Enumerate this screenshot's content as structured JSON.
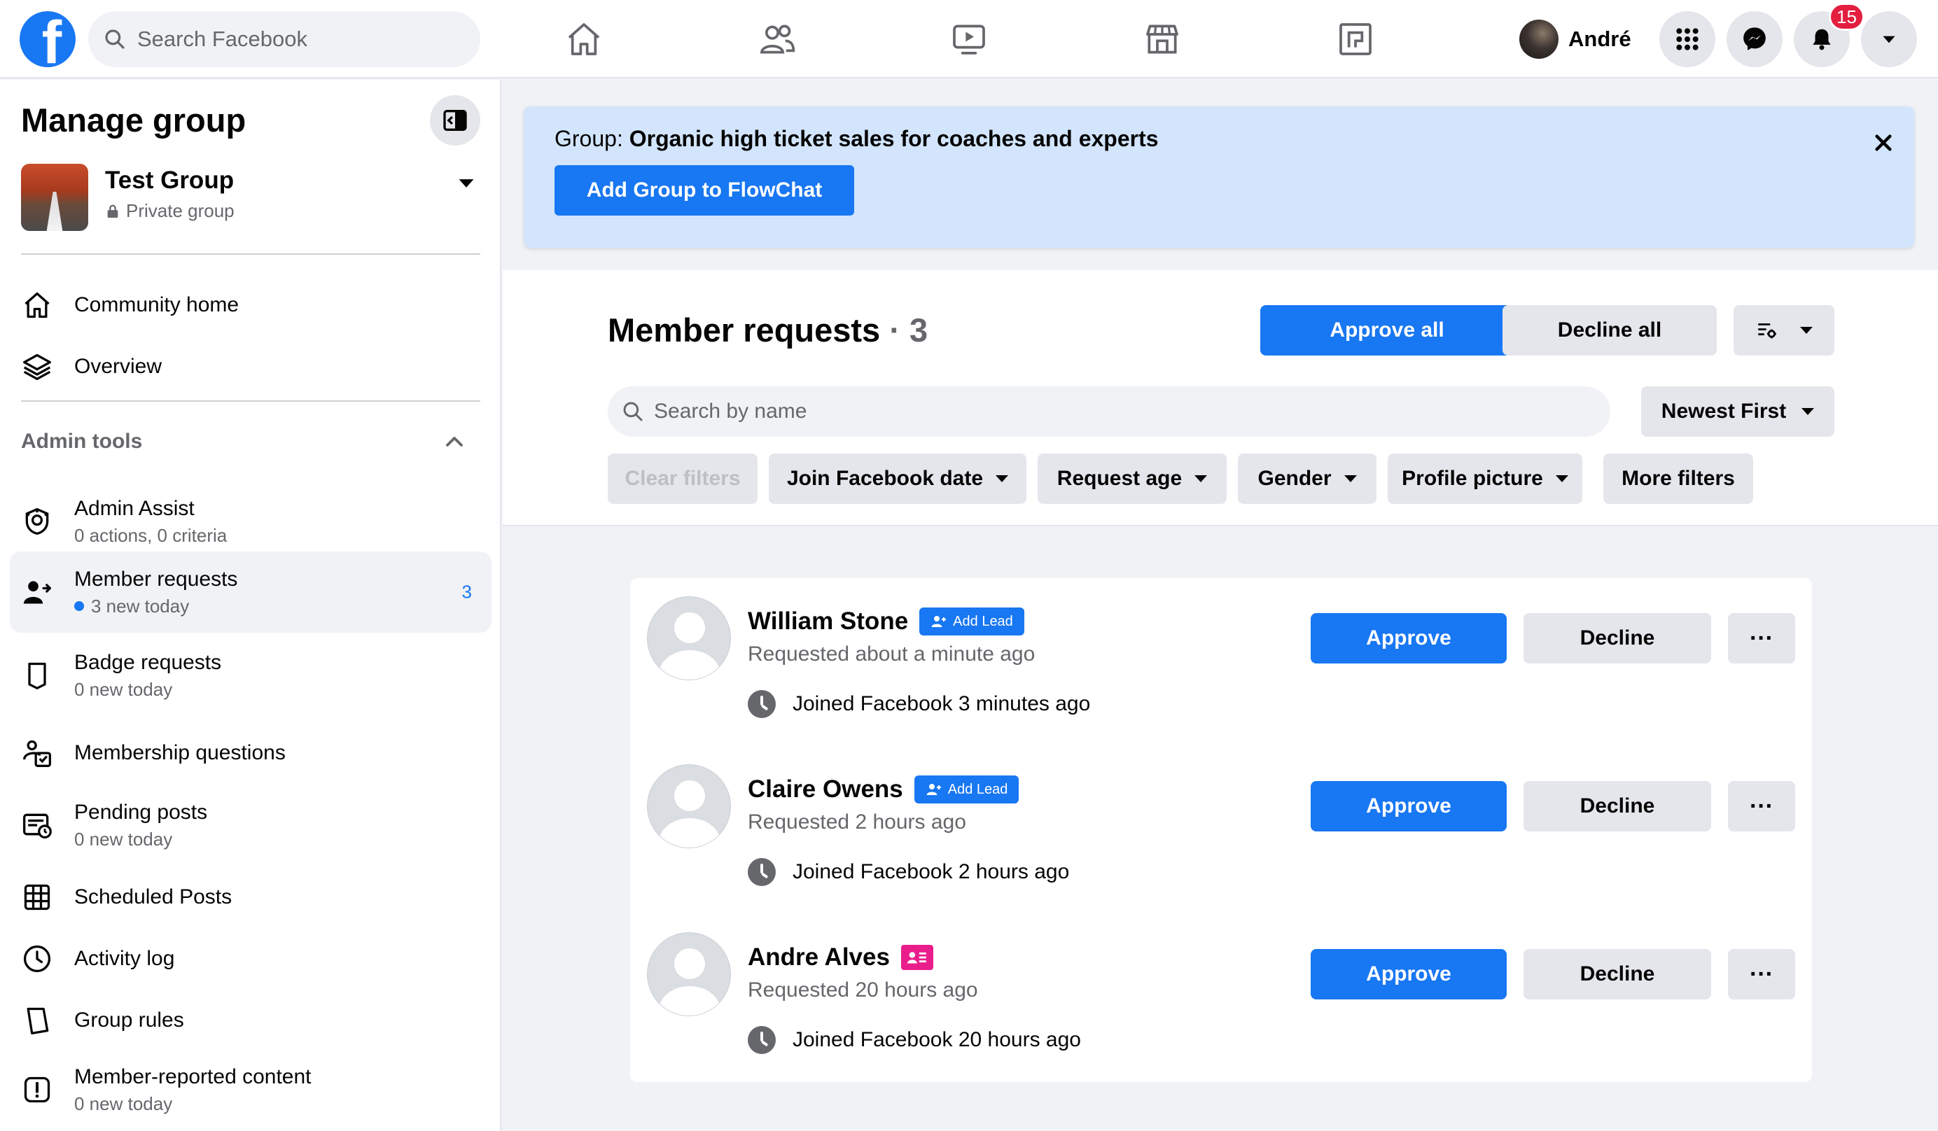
{
  "topbar": {
    "search_placeholder": "Search Facebook",
    "user_name": "André",
    "notification_count": "15",
    "nav_icons": [
      "home-icon",
      "friends-icon",
      "watch-icon",
      "marketplace-icon",
      "gaming-icon"
    ]
  },
  "sidebar": {
    "title": "Manage group",
    "group": {
      "name": "Test Group",
      "privacy": "Private group"
    },
    "top_items": [
      {
        "label": "Community home",
        "icon": "home-icon"
      },
      {
        "label": "Overview",
        "icon": "layers-icon"
      }
    ],
    "section_label": "Admin tools",
    "admin_items": [
      {
        "label": "Admin Assist",
        "sub": "0 actions, 0 criteria",
        "icon": "admin-assist-icon"
      },
      {
        "label": "Member requests",
        "sub": "3 new today",
        "count": "3",
        "icon": "member-requests-icon"
      },
      {
        "label": "Badge requests",
        "sub": "0 new today",
        "icon": "badge-icon"
      },
      {
        "label": "Membership questions",
        "icon": "questions-icon"
      },
      {
        "label": "Pending posts",
        "sub": "0 new today",
        "icon": "pending-posts-icon"
      },
      {
        "label": "Scheduled Posts",
        "icon": "calendar-icon"
      },
      {
        "label": "Activity log",
        "icon": "clock-icon"
      },
      {
        "label": "Group rules",
        "icon": "rules-icon"
      },
      {
        "label": "Member-reported content",
        "sub": "0 new today",
        "icon": "report-icon"
      }
    ]
  },
  "banner": {
    "prefix": "Group: ",
    "group_name": "Organic high ticket sales for coaches and experts",
    "button_label": "Add Group to FlowChat"
  },
  "requests": {
    "title": "Member requests",
    "count": "3",
    "approve_all": "Approve all",
    "decline_all": "Decline all",
    "search_placeholder": "Search by name",
    "sort": "Newest First",
    "filters": {
      "clear": "Clear filters",
      "join_date": "Join Facebook date",
      "request_age": "Request age",
      "gender": "Gender",
      "profile_picture": "Profile picture",
      "more": "More filters"
    },
    "members": [
      {
        "name": "William Stone",
        "requested": "Requested about a minute ago",
        "joined": "Joined Facebook 3 minutes ago",
        "tag": "Add Lead"
      },
      {
        "name": "Claire Owens",
        "requested": "Requested 2 hours ago",
        "joined": "Joined Facebook 2 hours ago",
        "tag": "Add Lead"
      },
      {
        "name": "Andre Alves",
        "requested": "Requested 20 hours ago",
        "joined": "Joined Facebook 20 hours ago",
        "tag": ""
      }
    ],
    "approve_label": "Approve",
    "decline_label": "Decline",
    "more_label": "···"
  },
  "colors": {
    "brand": "#1877f2",
    "banner_bg": "#d2e5fc",
    "notification": "#e41e3f",
    "contact_tag": "#e91e8c"
  }
}
